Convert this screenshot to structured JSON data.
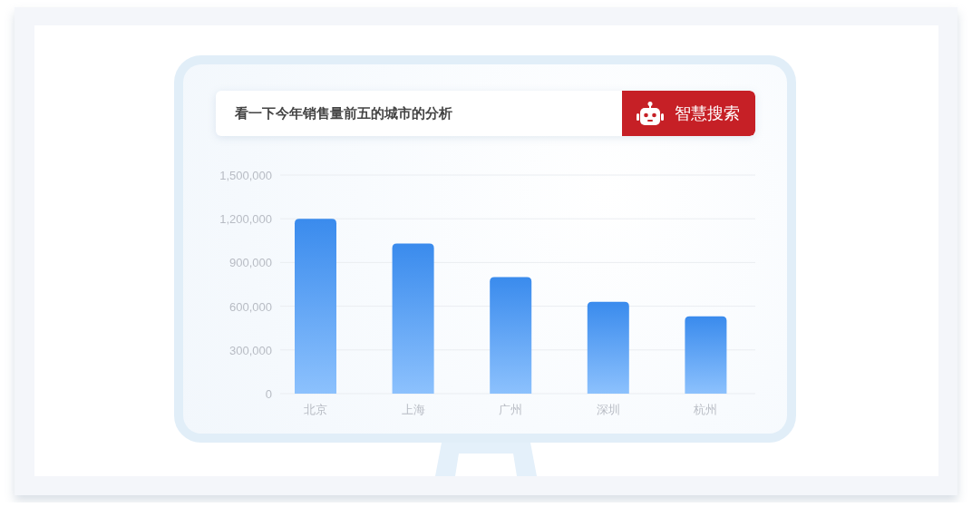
{
  "search": {
    "value": "看一下今年销售量前五的城市的分析",
    "button": "智慧搜索"
  },
  "chart_data": {
    "type": "bar",
    "categories": [
      "北京",
      "上海",
      "广州",
      "深圳",
      "杭州"
    ],
    "series": [
      {
        "color": "#3a8bed",
        "values": [
          1200000,
          1030000,
          800000,
          630000,
          530000
        ]
      }
    ],
    "grid": true,
    "ylim": [
      0,
      1500000
    ],
    "yticks": [
      {
        "value": 0,
        "label": "0"
      },
      {
        "value": 300000,
        "label": "300,000"
      },
      {
        "value": 600000,
        "label": "600,000"
      },
      {
        "value": 900000,
        "label": "900,000"
      },
      {
        "value": 1200000,
        "label": "1,200,000"
      },
      {
        "value": 1500000,
        "label": "1,500,000"
      }
    ]
  }
}
